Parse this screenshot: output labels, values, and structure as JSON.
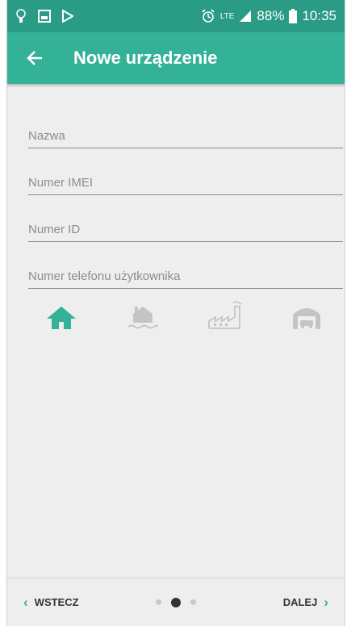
{
  "status_bar": {
    "network": "LTE",
    "battery": "88%",
    "time": "10:35",
    "icons": [
      "notification-icon",
      "gallery-icon",
      "play-store-icon",
      "alarm-icon",
      "signal-icon",
      "battery-icon"
    ]
  },
  "app_bar": {
    "title": "Nowe urządzenie",
    "back_icon": "arrow-left-icon"
  },
  "form": {
    "fields": [
      {
        "placeholder": "Nazwa",
        "value": ""
      },
      {
        "placeholder": "Numer IMEI",
        "value": ""
      },
      {
        "placeholder": "Numer ID",
        "value": ""
      },
      {
        "placeholder": "Numer telefonu użytkownika",
        "value": ""
      }
    ]
  },
  "device_types": {
    "selected": "house",
    "items": [
      {
        "name": "house-icon",
        "selected": true
      },
      {
        "name": "boat-house-icon",
        "selected": false
      },
      {
        "name": "factory-icon",
        "selected": false
      },
      {
        "name": "garage-icon",
        "selected": false
      }
    ]
  },
  "bottom_nav": {
    "back_label": "WSTECZ",
    "next_label": "DALEJ",
    "page_index": 2,
    "page_count": 3
  },
  "colors": {
    "status_bar": "#2a9c85",
    "app_bar": "#34b298",
    "accent": "#34b298",
    "inactive_icon": "#c4c4c4",
    "background": "#eeeeee"
  }
}
